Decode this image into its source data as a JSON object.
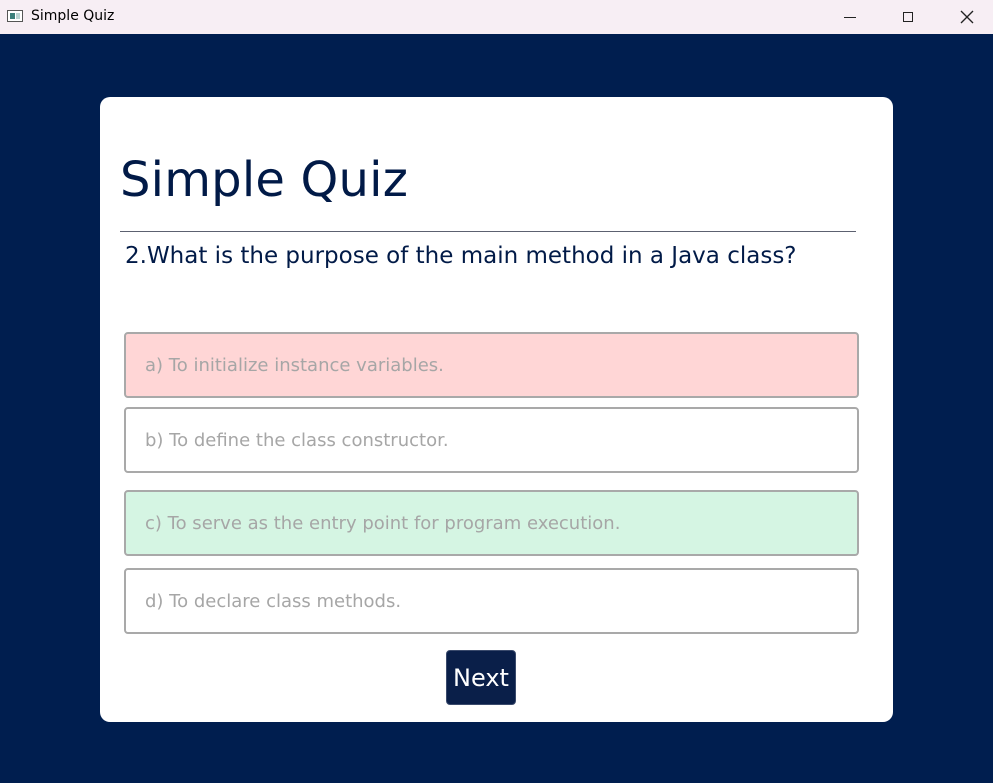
{
  "window": {
    "title": "Simple Quiz",
    "icon": "app-window-icon",
    "controls": {
      "minimize": "minimize-icon",
      "maximize": "maximize-icon",
      "close": "close-icon",
      "close_glyph": "✕"
    }
  },
  "quiz": {
    "title": "Simple Quiz",
    "question": "2.What is the purpose of the main method in a Java class?",
    "options": [
      {
        "label": "a) To initialize instance variables.",
        "state": "incorrect",
        "color": "#ffd6d6"
      },
      {
        "label": "b) To define the class constructor.",
        "state": "neutral",
        "color": "#ffffff"
      },
      {
        "label": "c) To serve as the entry point for program execution.",
        "state": "correct",
        "color": "#d5f5e3"
      },
      {
        "label": "d) To declare class methods.",
        "state": "neutral",
        "color": "#ffffff"
      }
    ],
    "next_label": "Next"
  },
  "colors": {
    "background": "#001e4f",
    "card": "#ffffff",
    "title_text": "#011a47",
    "option_text": "#a6a6a6",
    "incorrect": "#ffd6d6",
    "correct": "#d5f5e3",
    "button": "#0a1f49"
  }
}
